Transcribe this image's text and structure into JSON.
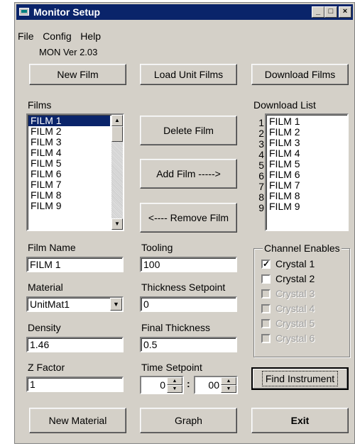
{
  "window": {
    "title": "Monitor Setup",
    "version": "MON Ver 2.03",
    "min_label": "_",
    "max_label": "□",
    "close_label": "×"
  },
  "menu": {
    "file": "File",
    "config": "Config",
    "help": "Help"
  },
  "top_buttons": {
    "new_film": "New Film",
    "load_unit_films": "Load Unit Films",
    "download_films": "Download Films"
  },
  "films": {
    "label": "Films",
    "items": [
      "FILM 1",
      "FILM 2",
      "FILM 3",
      "FILM 4",
      "FILM 5",
      "FILM 6",
      "FILM 7",
      "FILM 8",
      "FILM 9"
    ],
    "selected_index": 0
  },
  "middle_buttons": {
    "delete_film": "Delete Film",
    "add_film": "Add Film  ----->",
    "remove_film": "<---- Remove Film"
  },
  "download_list": {
    "label": "Download List",
    "numbers": [
      "1",
      "2",
      "3",
      "4",
      "5",
      "6",
      "7",
      "8",
      "9"
    ],
    "items": [
      "FILM 1",
      "FILM 2",
      "FILM 3",
      "FILM 4",
      "FILM 5",
      "FILM 6",
      "FILM 7",
      "FILM 8",
      "FILM 9"
    ]
  },
  "fields": {
    "film_name": {
      "label": "Film Name",
      "value": "FILM 1"
    },
    "material": {
      "label": "Material",
      "value": "UnitMat1"
    },
    "density": {
      "label": "Density",
      "value": "1.46"
    },
    "z_factor": {
      "label": "Z Factor",
      "value": "1"
    },
    "tooling": {
      "label": "Tooling",
      "value": "100"
    },
    "thickness_setpoint": {
      "label": "Thickness Setpoint",
      "value": "0"
    },
    "final_thickness": {
      "label": "Final Thickness",
      "value": "0.5"
    },
    "time_setpoint": {
      "label": "Time Setpoint",
      "minutes": "0",
      "seconds": "00",
      "separator": ":"
    }
  },
  "channel_enables": {
    "title": "Channel Enables",
    "channels": [
      {
        "label": "Crystal 1",
        "checked": true,
        "enabled": true
      },
      {
        "label": "Crystal 2",
        "checked": false,
        "enabled": true
      },
      {
        "label": "Crystal 3",
        "checked": false,
        "enabled": false
      },
      {
        "label": "Crystal 4",
        "checked": false,
        "enabled": false
      },
      {
        "label": "Crystal 5",
        "checked": false,
        "enabled": false
      },
      {
        "label": "Crystal 6",
        "checked": false,
        "enabled": false
      }
    ]
  },
  "bottom_buttons": {
    "find_instrument": "Find Instrument",
    "new_material": "New Material",
    "graph": "Graph",
    "exit": "Exit"
  }
}
